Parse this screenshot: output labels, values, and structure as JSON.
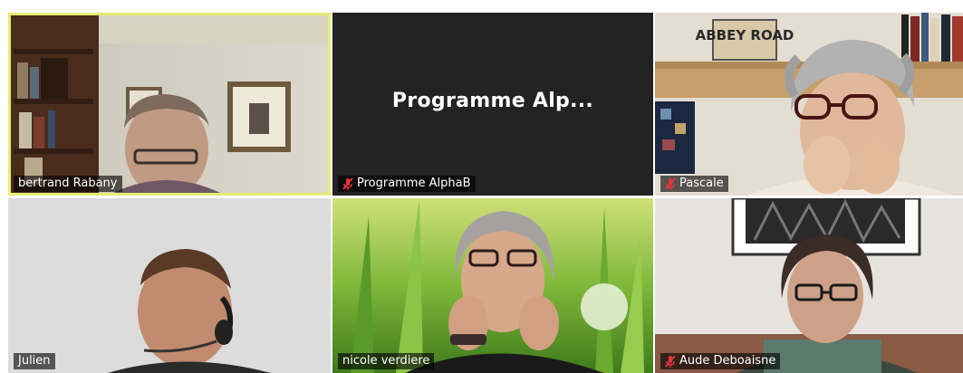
{
  "participants": [
    {
      "name": "bertrand Rabany",
      "muted": false,
      "active": true
    },
    {
      "name": "Programme AlphaB",
      "display_title": "Programme  Alp...",
      "muted": true,
      "active": false
    },
    {
      "name": "Pascale",
      "muted": true,
      "active": false
    },
    {
      "name": "Julien",
      "muted": false,
      "active": false
    },
    {
      "name": "nicole verdiere",
      "muted": false,
      "active": false
    },
    {
      "name": "Aude Deboaisne",
      "muted": true,
      "active": false
    }
  ],
  "scene_text": {
    "record_sleeve": "ABBEY ROAD"
  },
  "colors": {
    "active_speaker_border": "#e8ef6a",
    "muted_mic": "#e8343a",
    "name_tag_bg": "rgba(0,0,0,0.62)",
    "placeholder_bg": "#232323"
  }
}
